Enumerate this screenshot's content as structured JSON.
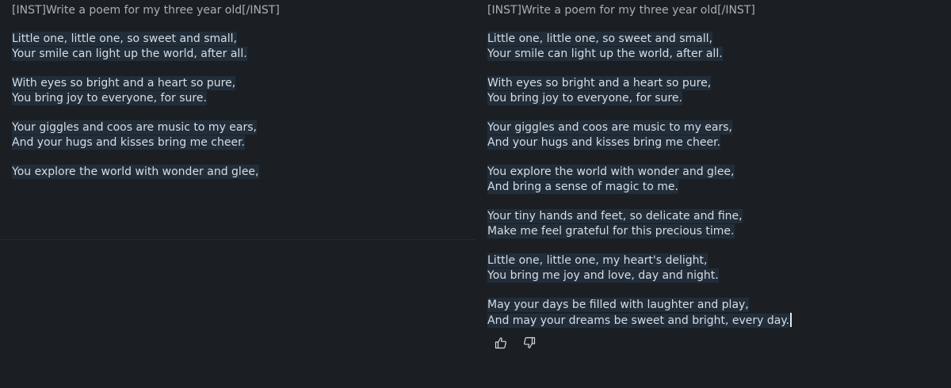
{
  "left": {
    "prompt": "[INST]Write a poem for my three year old[/INST]",
    "stanzas": [
      [
        "Little one, little one, so sweet and small,",
        "Your smile can light up the world, after all."
      ],
      [
        "With eyes so bright and a heart so pure,",
        "You bring joy to everyone, for sure."
      ],
      [
        "Your giggles and coos are music to my ears,",
        "And your hugs and kisses bring me cheer."
      ],
      [
        "You explore the world with wonder and glee,"
      ]
    ]
  },
  "right": {
    "prompt": "[INST]Write a poem for my three year old[/INST]",
    "stanzas": [
      [
        "Little one, little one, so sweet and small,",
        "Your smile can light up the world, after all."
      ],
      [
        "With eyes so bright and a heart so pure,",
        "You bring joy to everyone, for sure."
      ],
      [
        "Your giggles and coos are music to my ears,",
        "And your hugs and kisses bring me cheer."
      ],
      [
        "You explore the world with wonder and glee,",
        "And bring a sense of magic to me."
      ],
      [
        "Your tiny hands and feet, so delicate and fine,",
        "Make me feel grateful for this precious time."
      ],
      [
        "Little one, little one, my heart's delight,",
        "You bring me joy and love, day and night."
      ],
      [
        "May your days be filled with laughter and play,",
        "And may your dreams be sweet and bright, every day."
      ]
    ],
    "feedback": {
      "thumbs_up": "thumbs-up-icon",
      "thumbs_down": "thumbs-down-icon"
    }
  },
  "colors": {
    "background": "#1b1f24",
    "highlight": "#222d3a",
    "text": "#d7dde3",
    "prompt_text": "#a7b0b9"
  }
}
